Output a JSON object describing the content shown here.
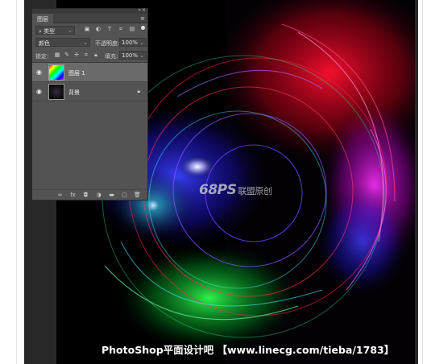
{
  "panel": {
    "tab_label": "图层",
    "filter_label": "类型",
    "blend_mode": "颜色",
    "opacity_label": "不透明度:",
    "opacity_value": "100%",
    "lock_label": "锁定:",
    "fill_label": "填充:",
    "fill_value": "100%",
    "layers": [
      {
        "name": "图层 1",
        "selected": true
      },
      {
        "name": "背景",
        "locked": true
      }
    ]
  },
  "watermark": {
    "logo": "68PS",
    "text": "联盟原创"
  },
  "caption": "PhotoShop平面设计吧 【www.linecg.com/tieba/1783】"
}
